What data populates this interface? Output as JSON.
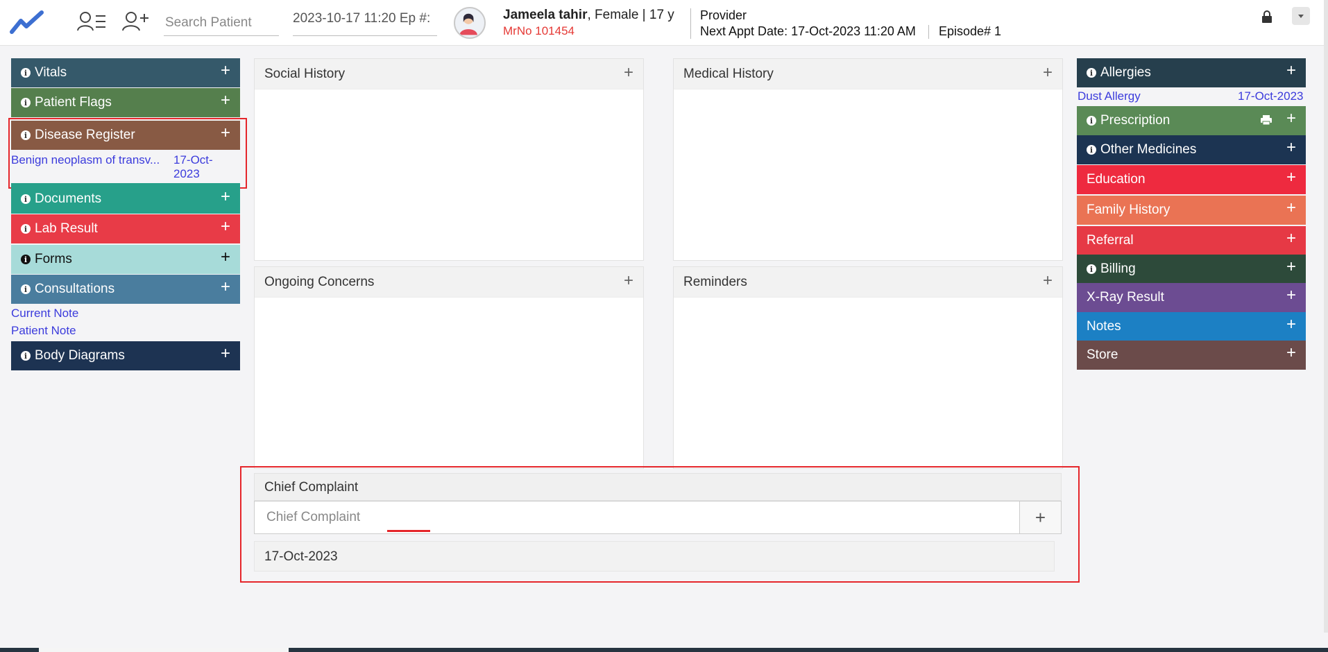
{
  "header": {
    "search_placeholder": "Search Patient",
    "date_episode": "2023-10-17 11:20 Ep #:",
    "patient_name": "Jameela tahir",
    "patient_details": ", Female | 17 y",
    "mrno": "MrNo 101454",
    "provider": "Provider",
    "next_appt_label": "Next Appt Date",
    "next_appt_value": ": 17-Oct-2023 11:20 AM",
    "episode": "Episode# 1"
  },
  "left_panels": {
    "vitals": "Vitals",
    "patient_flags": "Patient Flags",
    "disease_register": "Disease Register",
    "disease_item": "Benign neoplasm of transv...",
    "disease_date_line1": "17-Oct-",
    "disease_date_line2": "2023",
    "documents": "Documents",
    "lab_result": "Lab Result",
    "forms": "Forms",
    "consultations": "Consultations",
    "current_note": "Current Note",
    "patient_note": "Patient Note",
    "body_diagrams": "Body Diagrams"
  },
  "center": {
    "social_history": "Social History",
    "medical_history": "Medical History",
    "ongoing_concerns": "Ongoing Concerns",
    "reminders": "Reminders",
    "chief_complaint_title": "Chief Complaint",
    "chief_complaint_placeholder": "Chief Complaint",
    "chief_complaint_date": "17-Oct-2023"
  },
  "right_panels": {
    "allergies": "Allergies",
    "allergy_item": "Dust Allergy",
    "allergy_date": "17-Oct-2023",
    "prescription": "Prescription",
    "other_medicines": "Other Medicines",
    "education": "Education",
    "family_history": "Family History",
    "referral": "Referral",
    "billing": "Billing",
    "xray_result": "X-Ray Result",
    "notes": "Notes",
    "store": "Store"
  },
  "icons": {
    "plus": "+",
    "info": "i"
  },
  "colors": {
    "vitals": "#35596a",
    "patient_flags": "#557f4d",
    "disease_register": "#885a44",
    "documents": "#27a08a",
    "lab_result": "#e83b47",
    "forms": "#a7dbd9",
    "consultations": "#4a7d9e",
    "body_diagrams": "#1d3352",
    "allergies": "#263f4d",
    "prescription": "#5a8a56",
    "other_medicines": "#1c3452",
    "education": "#ee2a3f",
    "family_history": "#ea7354",
    "referral": "#e63945",
    "billing": "#2d4a3a",
    "xray_result": "#6c4c92",
    "notes": "#1c80c4",
    "store": "#6b4b4a",
    "highlight_box": "#e5262b",
    "link": "#3b3bdc",
    "mrno": "#e53935"
  }
}
